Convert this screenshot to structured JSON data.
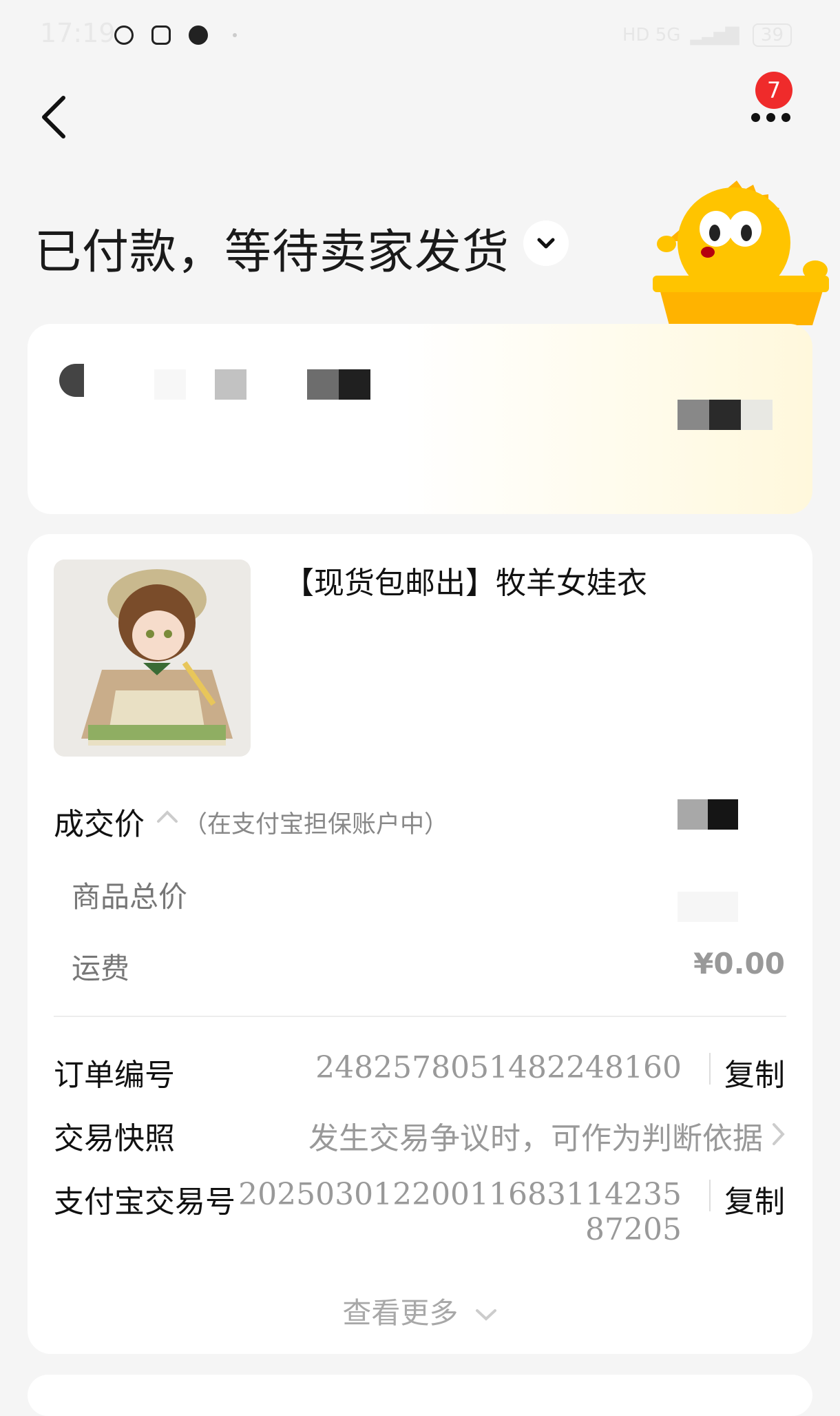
{
  "status_bar": {
    "time": "17:19",
    "network": "HD 5G",
    "battery": "39"
  },
  "nav": {
    "back_icon": "chevron-left-icon",
    "more_icon": "more-dots-icon",
    "badge_count": "7"
  },
  "header": {
    "title": "已付款，等待卖家发货"
  },
  "product": {
    "title": "【现货包邮出】牧羊女娃衣"
  },
  "price": {
    "deal_label": "成交价",
    "deal_hint": "（在支付宝担保账户中）",
    "total_label": "商品总价",
    "shipping_label": "运费",
    "shipping_value": "¥0.00"
  },
  "order": {
    "order_no_label": "订单编号",
    "order_no_value": "2482578051482248160",
    "copy_label": "复制",
    "snapshot_label": "交易快照",
    "snapshot_value": "发生交易争议时，可作为判断依据",
    "alipay_label": "支付宝交易号",
    "alipay_value_line1": "2025030122001168311423​5",
    "alipay_value_line2": "87205",
    "see_more": "查看更多"
  }
}
